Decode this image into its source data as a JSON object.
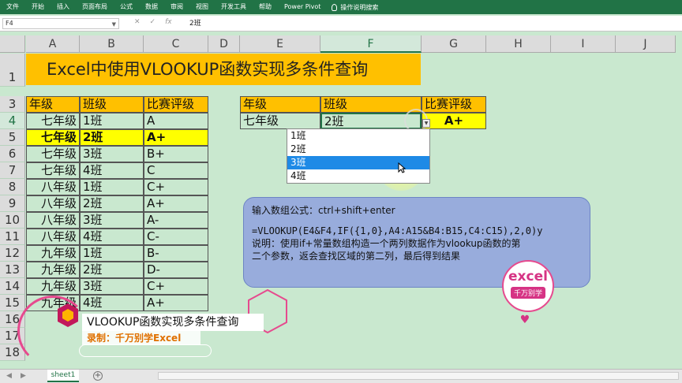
{
  "ribbon": {
    "menu": [
      "文件",
      "开始",
      "插入",
      "页面布局",
      "公式",
      "数据",
      "审阅",
      "视图",
      "开发工具",
      "帮助",
      "Power Pivot"
    ],
    "tell_me": "操作说明搜索"
  },
  "formula_bar": {
    "name_box": "F4",
    "value": "2班"
  },
  "columns": [
    "A",
    "B",
    "C",
    "D",
    "E",
    "F",
    "G",
    "H",
    "I",
    "J"
  ],
  "rows": [
    "1",
    "3",
    "4",
    "5",
    "6",
    "7",
    "8",
    "9",
    "10",
    "11",
    "12",
    "13",
    "14",
    "15",
    "16",
    "17",
    "18"
  ],
  "title": "Excel中使用VLOOKUP函数实现多条件查询",
  "table": {
    "headers": [
      "年级",
      "班级",
      "比赛评级"
    ],
    "rows": [
      [
        "七年级",
        "1班",
        "A"
      ],
      [
        "七年级",
        "2班",
        "A+"
      ],
      [
        "七年级",
        "3班",
        "B+"
      ],
      [
        "七年级",
        "4班",
        "C"
      ],
      [
        "八年级",
        "1班",
        "C+"
      ],
      [
        "八年级",
        "2班",
        "A+"
      ],
      [
        "八年级",
        "3班",
        "A-"
      ],
      [
        "八年级",
        "4班",
        "C-"
      ],
      [
        "九年级",
        "1班",
        "B-"
      ],
      [
        "九年级",
        "2班",
        "D-"
      ],
      [
        "九年级",
        "3班",
        "C+"
      ],
      [
        "九年级",
        "4班",
        "A+"
      ]
    ]
  },
  "lookup": {
    "headers": [
      "年级",
      "班级",
      "比赛评级"
    ],
    "values": [
      "七年级",
      "2班",
      "A+"
    ]
  },
  "dropdown": {
    "options": [
      "1班",
      "2班",
      "3班",
      "4班"
    ],
    "selected_index": 2
  },
  "note": {
    "line1": "输入数组公式：ctrl+shift+enter",
    "line2": "=VLOOKUP(E4&F4,IF({1,0},A4:A15&B4:B15,C4:C15),2,0)y",
    "line3": "说明：使用if+常量数组构造一个两列数据作为vlookup函数的第",
    "line4": "二个参数，返会查找区域的第二列，最后得到结果"
  },
  "logo": {
    "text": "excel",
    "sub": "千万别学"
  },
  "overlay": {
    "title": "VLOOKUP函数实现多条件查询",
    "subtitle": "录制：千万别学Excel"
  },
  "sheet": {
    "tab": "sheet1",
    "add": "+"
  },
  "colors": {
    "excel_green": "#217346",
    "header_orange": "#ffc000",
    "highlight_yellow": "#ffff00",
    "sheet_bg": "#c9e8cf",
    "note_blue": "#98acdc",
    "brand_pink": "#d63384"
  }
}
